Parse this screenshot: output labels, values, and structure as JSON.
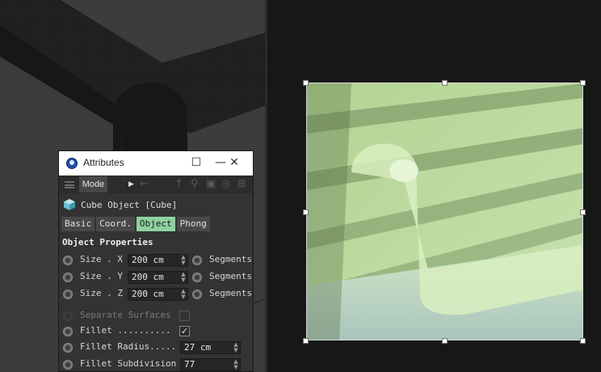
{
  "attributes": {
    "title": "Attributes",
    "window_controls": {
      "minimize": "—",
      "maximize": "☐",
      "close": "✕"
    },
    "toolbar": {
      "mode_label": "Mode"
    },
    "object_name": "Cube Object [Cube]",
    "tabs": [
      {
        "label": "Basic",
        "active": false
      },
      {
        "label": "Coord.",
        "active": false
      },
      {
        "label": "Object",
        "active": true
      },
      {
        "label": "Phong",
        "active": false
      }
    ],
    "section_title": "Object Properties",
    "size_rows": [
      {
        "label": "Size . X",
        "value": "200 cm",
        "secondary_label": "Segments"
      },
      {
        "label": "Size . Y",
        "value": "200 cm",
        "secondary_label": "Segments"
      },
      {
        "label": "Size . Z",
        "value": "200 cm",
        "secondary_label": "Segments"
      }
    ],
    "separate_surfaces": {
      "label": "Separate Surfaces",
      "checked": false
    },
    "fillet": {
      "label": "Fillet ..........",
      "checked": true
    },
    "fillet_radius": {
      "label": "Fillet Radius.....",
      "value": "27 cm"
    },
    "fillet_subdivision": {
      "label": "Fillet Subdivision",
      "value": "77"
    }
  },
  "colors": {
    "active_tab": "#8fd1a3",
    "panel_bg": "#333333",
    "viewport_bg": "#3c3c3c",
    "image_tint": "#c6e6a8"
  }
}
